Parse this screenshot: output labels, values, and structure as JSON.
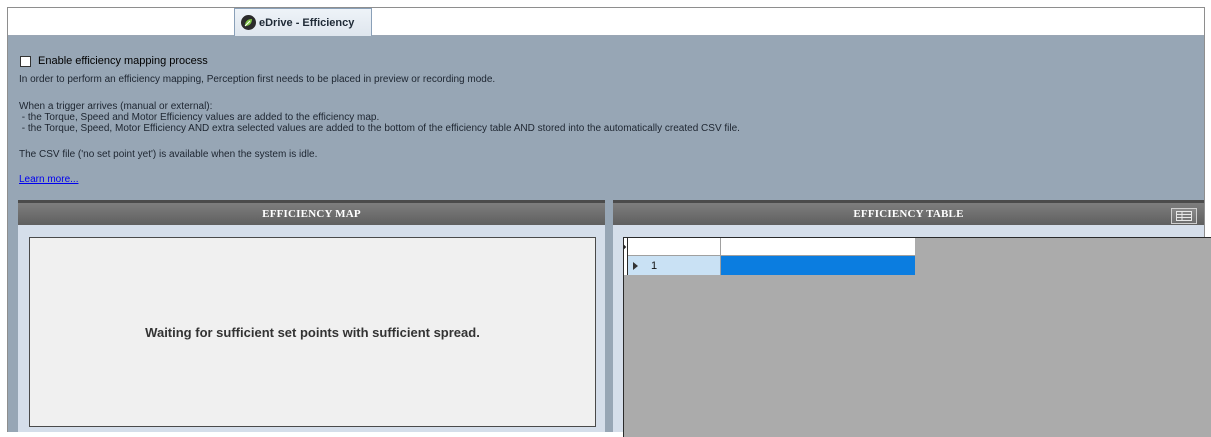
{
  "tab": {
    "label": "eDrive - Efficiency"
  },
  "enable": {
    "label": "Enable efficiency mapping process",
    "checked": false
  },
  "info": {
    "line1": "In order to perform an efficiency mapping, Perception first needs to be placed in preview or recording mode.",
    "line2": "When a trigger arrives (manual or external):",
    "line3": " - the Torque, Speed and Motor Efficiency values are added to the efficiency map.",
    "line4": " - the Torque, Speed, Motor Efficiency AND extra selected values are added to the bottom of the efficiency table AND stored into the automatically created CSV file.",
    "line5": "The CSV file ('no set point yet') is available when the system is idle.",
    "learn_more": "Learn more..."
  },
  "map": {
    "title": "EFFICIENCY MAP",
    "waiting": "Waiting for sufficient set points with sufficient spread."
  },
  "table": {
    "title": "EFFICIENCY TABLE",
    "rows": [
      {
        "index": "1",
        "value": ""
      }
    ]
  },
  "colors": {
    "content_bg": "#97a6b5",
    "selected_cell": "#0b7de0",
    "row_header": "#c9e1f4"
  }
}
